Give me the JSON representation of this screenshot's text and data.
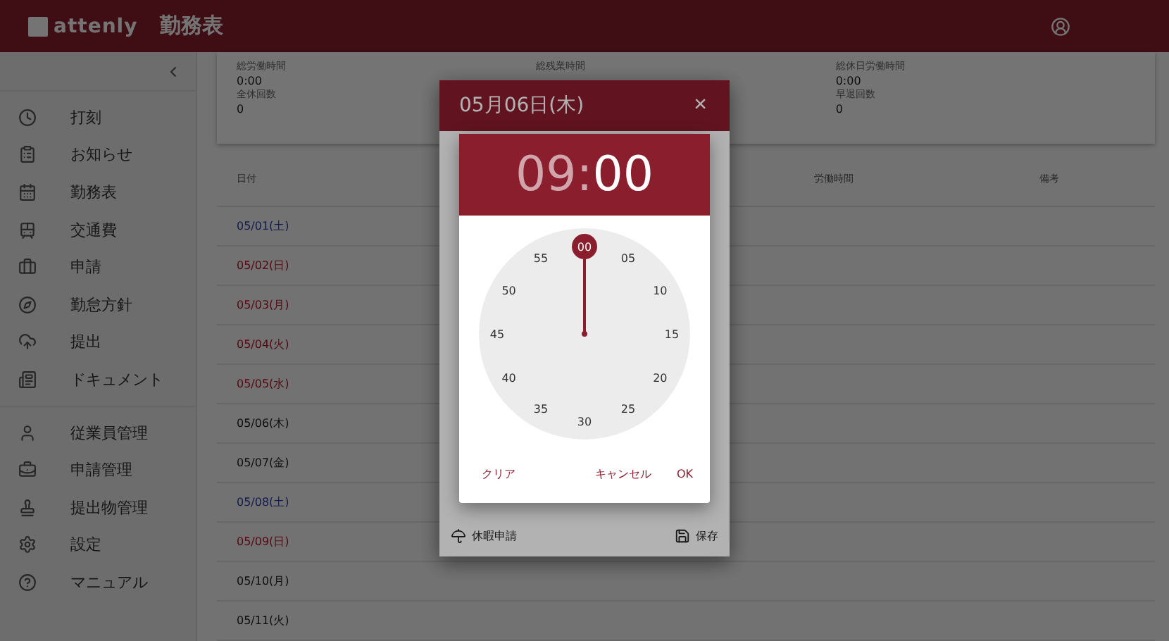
{
  "header": {
    "logo": "attenly",
    "title": "勤務表"
  },
  "sidebar": {
    "groups": [
      {
        "items": [
          {
            "label": "打刻"
          },
          {
            "label": "お知らせ"
          },
          {
            "label": "勤務表"
          },
          {
            "label": "交通費"
          },
          {
            "label": "申請"
          },
          {
            "label": "勤怠方針"
          },
          {
            "label": "提出"
          },
          {
            "label": "ドキュメント"
          }
        ]
      },
      {
        "items": [
          {
            "label": "従業員管理"
          },
          {
            "label": "申請管理"
          },
          {
            "label": "提出物管理"
          },
          {
            "label": "設定"
          },
          {
            "label": "マニュアル"
          }
        ]
      }
    ]
  },
  "summary": [
    {
      "items": [
        {
          "label": "総労働時間",
          "value": "0:00"
        },
        {
          "label": "全休回数",
          "value": "0"
        }
      ]
    },
    {
      "items": [
        {
          "label": "総残業時間"
        }
      ]
    },
    {
      "items": [
        {
          "label": "総休日労働時間",
          "value": "0:00"
        },
        {
          "label": "早退回数",
          "value": "0"
        }
      ]
    }
  ],
  "table": {
    "columns": [
      "日付",
      "労働時間",
      "備考"
    ],
    "rows": [
      {
        "date": "05/01(土)",
        "kind": "saturday"
      },
      {
        "date": "05/02(日)",
        "kind": "holiday"
      },
      {
        "date": "05/03(月)",
        "kind": "holiday"
      },
      {
        "date": "05/04(火)",
        "kind": "holiday"
      },
      {
        "date": "05/05(水)",
        "kind": "holiday"
      },
      {
        "date": "05/06(木)",
        "kind": "weekday"
      },
      {
        "date": "05/07(金)",
        "kind": "weekday"
      },
      {
        "date": "05/08(土)",
        "kind": "saturday"
      },
      {
        "date": "05/09(日)",
        "kind": "holiday"
      },
      {
        "date": "05/10(月)",
        "kind": "weekday"
      },
      {
        "date": "05/11(火)",
        "kind": "weekday"
      }
    ]
  },
  "dialog": {
    "title": "05月06日(木)",
    "close": "×",
    "footer": {
      "leave": "休暇申請",
      "save": "保存"
    }
  },
  "time_picker": {
    "hour": {
      "text": "09",
      "selected": false
    },
    "separator": ":",
    "minute": {
      "text": "00",
      "selected": true
    },
    "dial": [
      {
        "label": "00",
        "selected": true
      },
      {
        "label": "05",
        "selected": false
      },
      {
        "label": "10",
        "selected": false
      },
      {
        "label": "15",
        "selected": false
      },
      {
        "label": "20",
        "selected": false
      },
      {
        "label": "25",
        "selected": false
      },
      {
        "label": "30",
        "selected": false
      },
      {
        "label": "35",
        "selected": false
      },
      {
        "label": "40",
        "selected": false
      },
      {
        "label": "45",
        "selected": false
      },
      {
        "label": "50",
        "selected": false
      },
      {
        "label": "55",
        "selected": false
      }
    ],
    "buttons": {
      "clear": "クリア",
      "cancel": "キャンセル",
      "ok": "OK"
    }
  }
}
